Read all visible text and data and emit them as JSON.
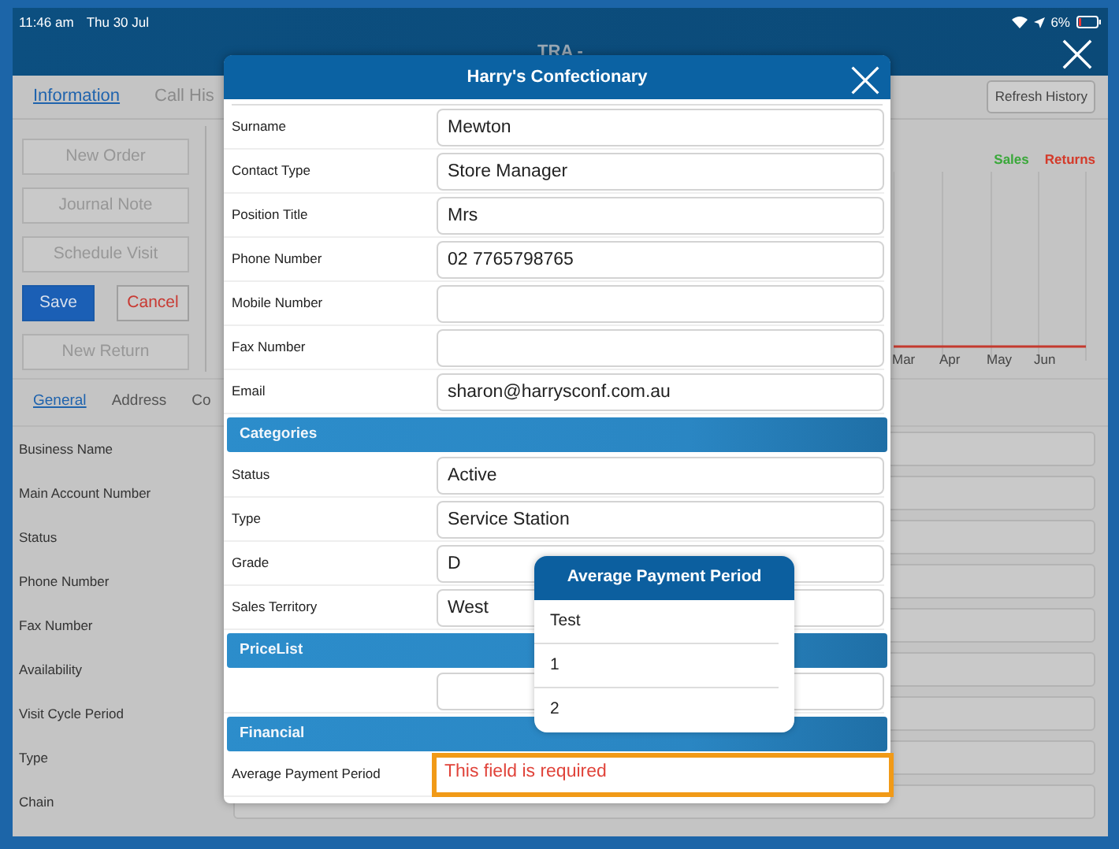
{
  "status_bar": {
    "time": "11:46 am",
    "date": "Thu 30 Jul",
    "battery": "6%"
  },
  "app": {
    "title": "TRA -",
    "tabs": [
      {
        "label": "Information",
        "selected": true
      },
      {
        "label": "Call His",
        "selected": false
      }
    ],
    "refresh_button": "Refresh History",
    "action_rows": [
      {
        "buttons": [
          {
            "label": "New Order",
            "kind": "disabled"
          }
        ]
      },
      {
        "buttons": [
          {
            "label": "Journal Note",
            "kind": "disabled"
          }
        ]
      },
      {
        "buttons": [
          {
            "label": "Schedule Visit",
            "kind": "disabled"
          }
        ]
      },
      {
        "buttons": [
          {
            "label": "Save",
            "kind": "primary"
          },
          {
            "label": "Cancel",
            "kind": "danger"
          }
        ]
      },
      {
        "buttons": [
          {
            "label": "New Return",
            "kind": "disabled"
          }
        ]
      }
    ],
    "chart": {
      "legend": [
        {
          "label": "Sales",
          "color": "#3aa83a"
        },
        {
          "label": "Returns",
          "color": "#d43a2a"
        }
      ],
      "months": [
        "Mar",
        "Apr",
        "May",
        "Jun"
      ]
    },
    "subtabs": [
      {
        "label": "General",
        "selected": true
      },
      {
        "label": "Address",
        "selected": false
      },
      {
        "label": "Co",
        "selected": false
      }
    ],
    "fields": [
      "Business Name",
      "Main Account Number",
      "Status",
      "Phone Number",
      "Fax Number",
      "Availability",
      "Visit Cycle Period",
      "Type",
      "Chain"
    ]
  },
  "dialog": {
    "title": "Harry's Confectionary",
    "sections": [
      {
        "rows": [
          {
            "label": "Surname",
            "value": "Mewton"
          },
          {
            "label": "Contact Type",
            "value": "Store Manager"
          },
          {
            "label": "Position Title",
            "value": "Mrs"
          },
          {
            "label": "Phone Number",
            "value": "02 7765798765"
          },
          {
            "label": "Mobile Number"
          },
          {
            "label": "Fax Number"
          },
          {
            "label": "Email",
            "value": "sharon@harrysconf.com.au"
          }
        ]
      },
      {
        "heading": "Categories",
        "rows": [
          {
            "label": "Status",
            "value": "Active"
          },
          {
            "label": "Type",
            "value": "Service Station"
          },
          {
            "label": "Grade",
            "value": "D"
          },
          {
            "label": "Sales Territory",
            "value": "West"
          }
        ]
      },
      {
        "heading": "PriceList",
        "rows": [
          {}
        ]
      },
      {
        "heading": "Financial",
        "rows": [
          {
            "label": "Average Payment Period",
            "error": "This field is required"
          }
        ]
      }
    ],
    "picker": {
      "title": "Average Payment Period",
      "options": [
        "Test",
        "1",
        "2"
      ]
    }
  }
}
